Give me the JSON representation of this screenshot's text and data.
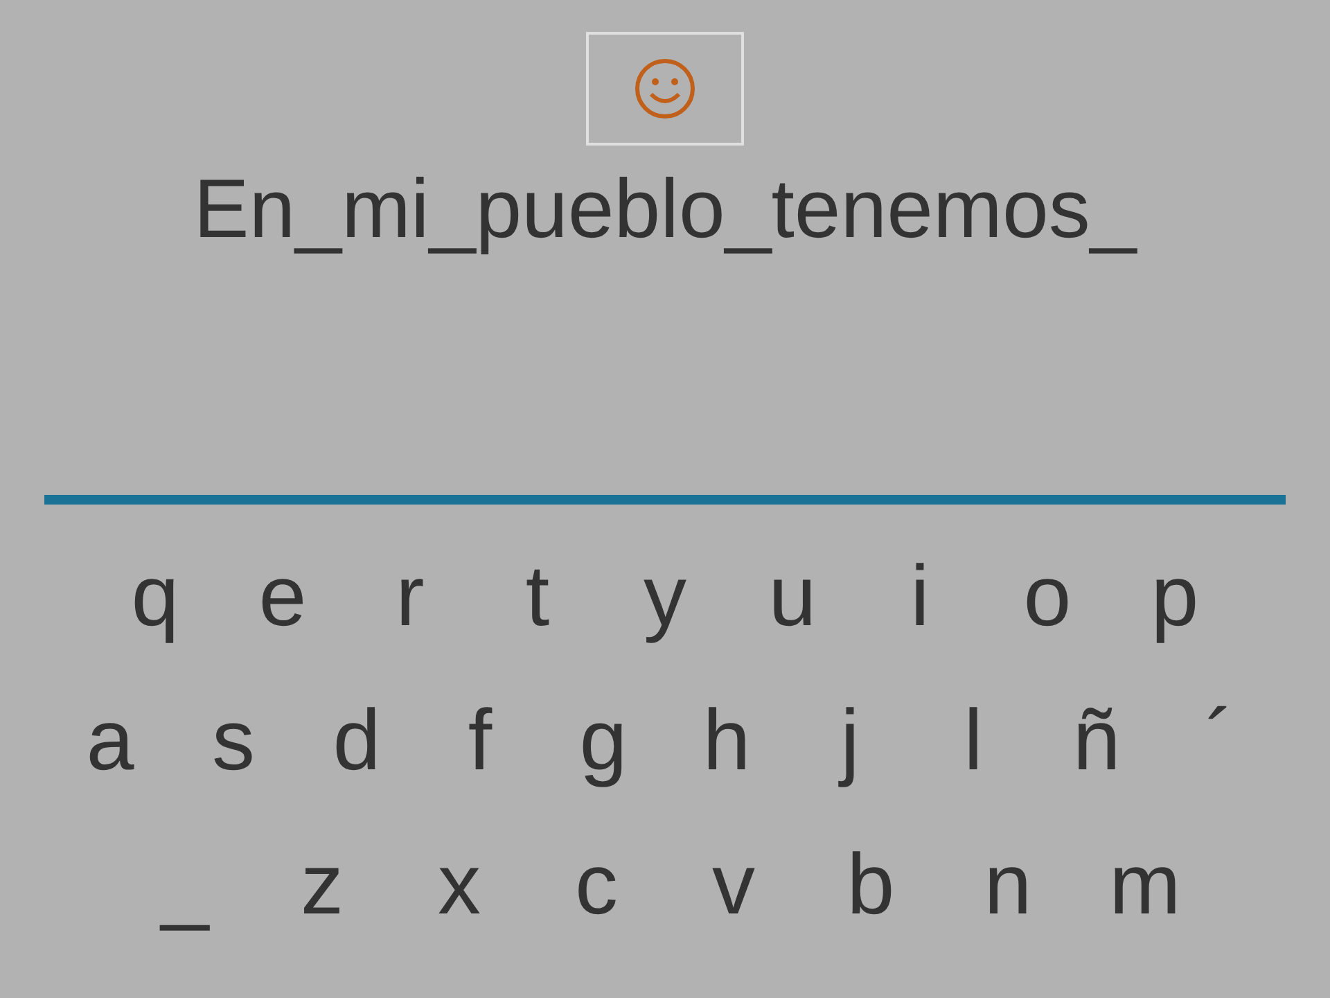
{
  "prompt": "En_mi_pueblo_tenemos_",
  "keyboard": [
    [
      "q",
      "e",
      "r",
      "t",
      "y",
      "u",
      "i",
      "o",
      "p"
    ],
    [
      "a",
      "s",
      "d",
      "f",
      "g",
      "h",
      "j",
      "l",
      "ñ",
      "´"
    ],
    [
      "_",
      "z",
      "x",
      "c",
      "v",
      "b",
      "n",
      "m"
    ]
  ]
}
